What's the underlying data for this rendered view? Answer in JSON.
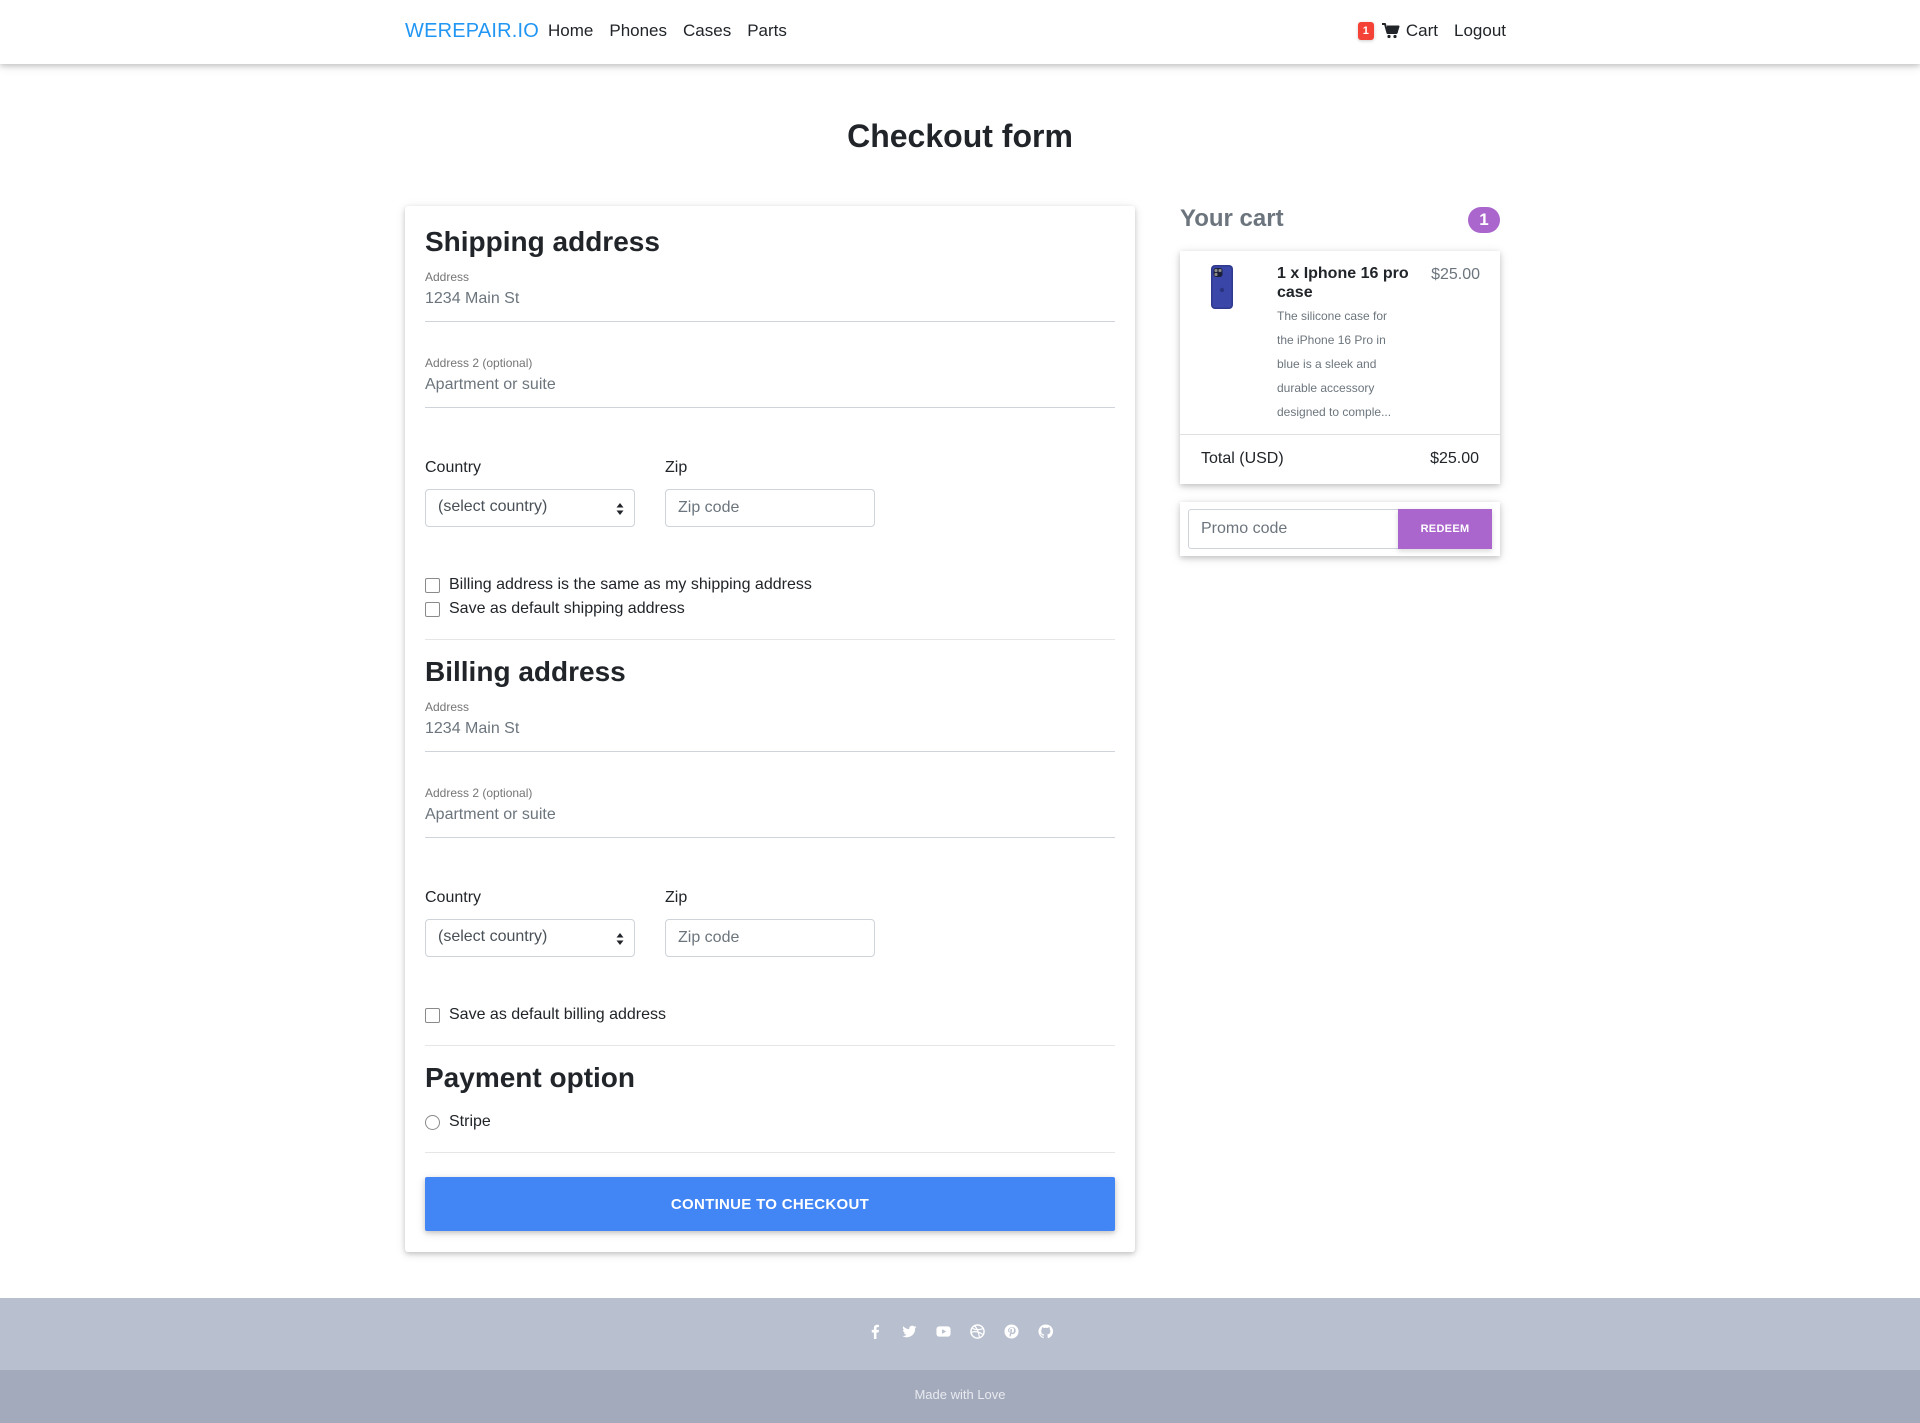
{
  "navbar": {
    "brand": "WEREPAIR.IO",
    "links": [
      "Home",
      "Phones",
      "Cases",
      "Parts"
    ],
    "cart_badge": "1",
    "cart_label": "Cart",
    "logout_label": "Logout"
  },
  "page_title": "Checkout form",
  "shipping": {
    "title": "Shipping address",
    "address_label": "Address",
    "address_placeholder": "1234 Main St",
    "address2_label": "Address 2 (optional)",
    "address2_placeholder": "Apartment or suite",
    "country_label": "Country",
    "country_value": "(select country)",
    "zip_label": "Zip",
    "zip_placeholder": "Zip code",
    "same_billing_label": "Billing address is the same as my shipping address",
    "save_default_label": "Save as default shipping address"
  },
  "billing": {
    "title": "Billing address",
    "address_label": "Address",
    "address_placeholder": "1234 Main St",
    "address2_label": "Address 2 (optional)",
    "address2_placeholder": "Apartment or suite",
    "country_label": "Country",
    "country_value": "(select country)",
    "zip_label": "Zip",
    "zip_placeholder": "Zip code",
    "save_default_label": "Save as default billing address"
  },
  "payment": {
    "title": "Payment option",
    "options": [
      "Stripe"
    ]
  },
  "checkout_button": "CONTINUE TO CHECKOUT",
  "cart": {
    "heading": "Your cart",
    "count": "1",
    "items": [
      {
        "title": "1 x Iphone 16 pro case",
        "description": "The silicone case for the iPhone 16 Pro in blue is a sleek and durable accessory designed to comple...",
        "price": "$25.00"
      }
    ],
    "total_label": "Total (USD)",
    "total_value": "$25.00",
    "promo_placeholder": "Promo code",
    "redeem_label": "REDEEM"
  },
  "footer": {
    "social_icons": [
      "facebook-icon",
      "twitter-icon",
      "youtube-icon",
      "dribbble-icon",
      "pinterest-icon",
      "github-icon"
    ],
    "text": "Made with Love"
  },
  "colors": {
    "brand": "#2196f3",
    "primary_button": "#4285f4",
    "accent_purple": "#aa66cc",
    "badge_red": "#f44336",
    "footer_top": "#b8bfce",
    "footer_bottom": "#a3aabb"
  }
}
